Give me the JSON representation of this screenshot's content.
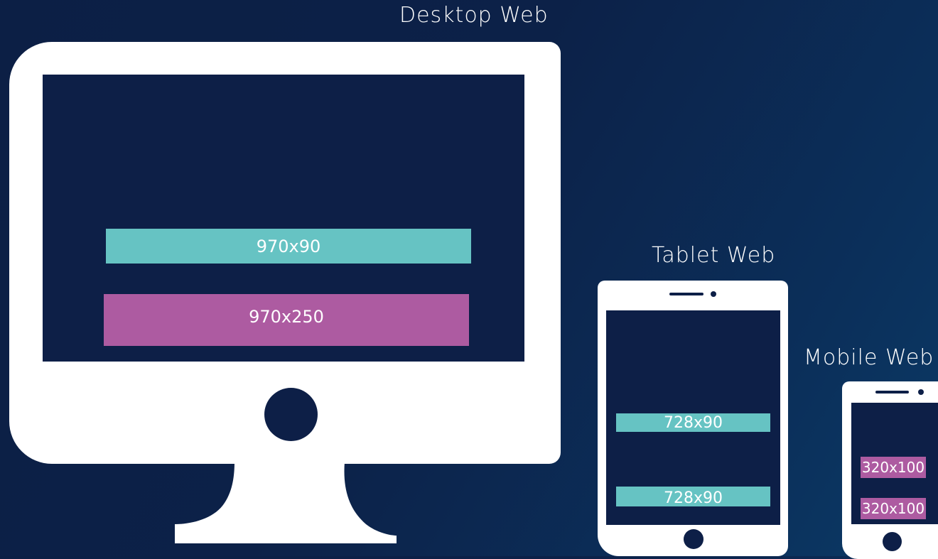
{
  "labels": {
    "desktop": "Desktop Web",
    "tablet": "Tablet Web",
    "mobile": "Mobile Web"
  },
  "desktop": {
    "ads": [
      {
        "label": "970x90",
        "color": "#66c3c3"
      },
      {
        "label": "970x250",
        "color": "#ad5ba1"
      }
    ]
  },
  "tablet": {
    "ads": [
      {
        "label": "728x90",
        "color": "#66c3c3"
      },
      {
        "label": "728x90",
        "color": "#66c3c3"
      }
    ]
  },
  "mobile": {
    "ads": [
      {
        "label": "320x100",
        "color": "#ad5ba1"
      },
      {
        "label": "320x100",
        "color": "#ad5ba1"
      }
    ]
  },
  "colors": {
    "background": "#0c1f45",
    "device": "#ffffff",
    "screen": "#0d1f47",
    "teal": "#66c3c3",
    "magenta": "#ad5ba1"
  }
}
